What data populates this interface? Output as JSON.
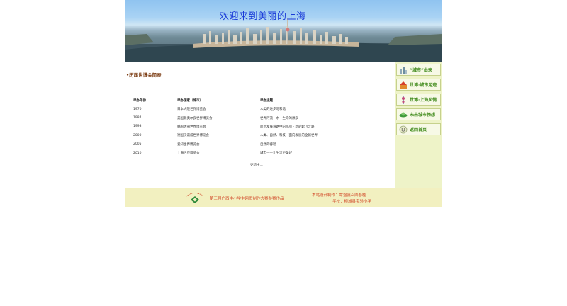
{
  "banner": {
    "title": "欢迎来到美丽的上海"
  },
  "main": {
    "section_title": "•历届世博会简表",
    "table": {
      "headers": [
        "举办年份",
        "举办国家（城市）",
        "举办主题"
      ],
      "rows": [
        [
          "1970",
          "日本大阪世界博览会",
          "人类的进步与和谐"
        ],
        [
          "1984",
          "美国新奥尔良世界博览会",
          "世界河流—水—生命的源泉"
        ],
        [
          "1993",
          "韩国大田世界博览会",
          "面对发展道路中的挑战 - 新的起飞之路"
        ],
        [
          "2000",
          "德国汉诺威世界博览会",
          "人类、自然、科技—面向发展的全新世界"
        ],
        [
          "2005",
          "爱知世界博览会",
          "自然的睿智"
        ],
        [
          "2010",
          "上海世界博览会",
          "城市——让生活更美好"
        ]
      ]
    },
    "more_text": "更新中..."
  },
  "sidebar": {
    "items": [
      {
        "label": "“城市”由来",
        "icon": "city-icon"
      },
      {
        "label": "世博·城市足迹",
        "icon": "footprint-icon"
      },
      {
        "label": "世博·上海风情",
        "icon": "tower-icon"
      },
      {
        "label": "未来城市畅想",
        "icon": "future-icon"
      },
      {
        "label": "返回首页",
        "icon": "home-smile-icon"
      }
    ]
  },
  "footer": {
    "contest": "第三届广西中小学生网页制作大赛参赛作品",
    "credit_line1": "本站设计制作：覃煜鑫&周春桂",
    "credit_line2": "学校：柳城县实验小学"
  },
  "colors": {
    "accent_green": "#3f8a1a",
    "footer_text": "#d24b2a",
    "title_blue": "#1a3bd8"
  }
}
